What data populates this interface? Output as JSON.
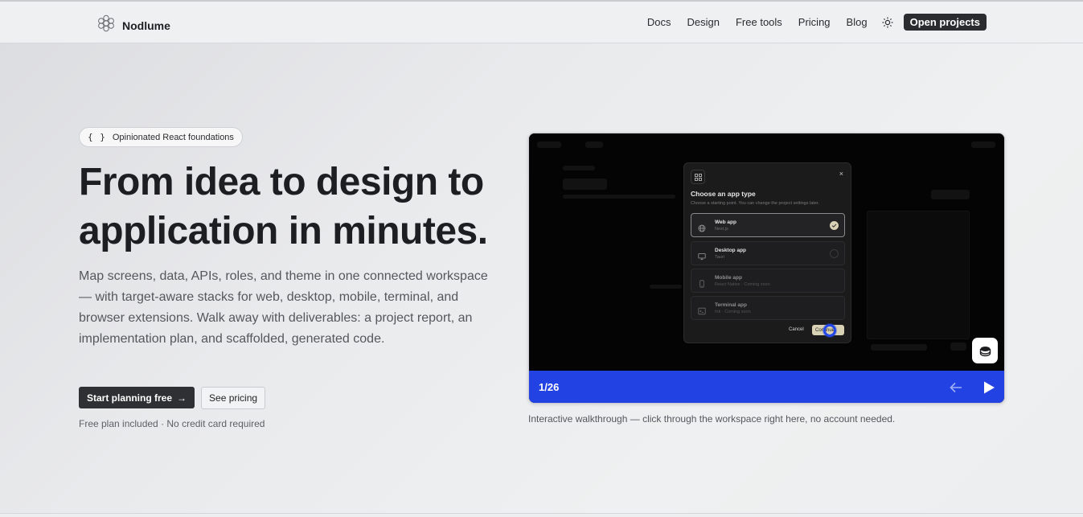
{
  "header": {
    "brand": "Nodlume",
    "nav": [
      "Docs",
      "Design",
      "Free tools",
      "Pricing",
      "Blog"
    ],
    "open_projects": "Open projects"
  },
  "hero": {
    "badge_icon": "{ }",
    "badge_text": "Opinionated React foundations",
    "title_line1": "From idea to design to",
    "title_line2": "application in minutes.",
    "description": "Map screens, data, APIs, roles, and theme in one connected workspace — with target-aware stacks for web, desktop, mobile, terminal, and browser extensions. Walk away with deliverables: a project report, an implementation plan, and scaffolded, generated code.",
    "cta_primary": "Start planning free",
    "cta_primary_arrow": "→",
    "cta_secondary": "See pricing",
    "note": "Free plan included · No credit card required"
  },
  "demo": {
    "modal": {
      "close": "×",
      "title": "Choose an app type",
      "subtitle": "Choose a starting point. You can change the project settings later.",
      "options": [
        {
          "title": "Web app",
          "sub": "Next.js",
          "icon": "globe-icon",
          "selected": true
        },
        {
          "title": "Desktop app",
          "sub": "Tauri",
          "icon": "monitor-icon",
          "selected": false
        },
        {
          "title": "Mobile app",
          "sub": "React Native · Coming soon",
          "icon": "phone-icon",
          "selected": false
        },
        {
          "title": "Terminal app",
          "sub": "Ink · Coming soon",
          "icon": "terminal-icon",
          "selected": false
        }
      ],
      "cancel": "Cancel",
      "continue": "Continue"
    },
    "step": "1/26",
    "caption": "Interactive walkthrough — click through the workspace right here, no account needed."
  },
  "colors": {
    "accent_blue": "#2342e4",
    "dark_button": "#2f3034",
    "background": "#eceeef"
  }
}
